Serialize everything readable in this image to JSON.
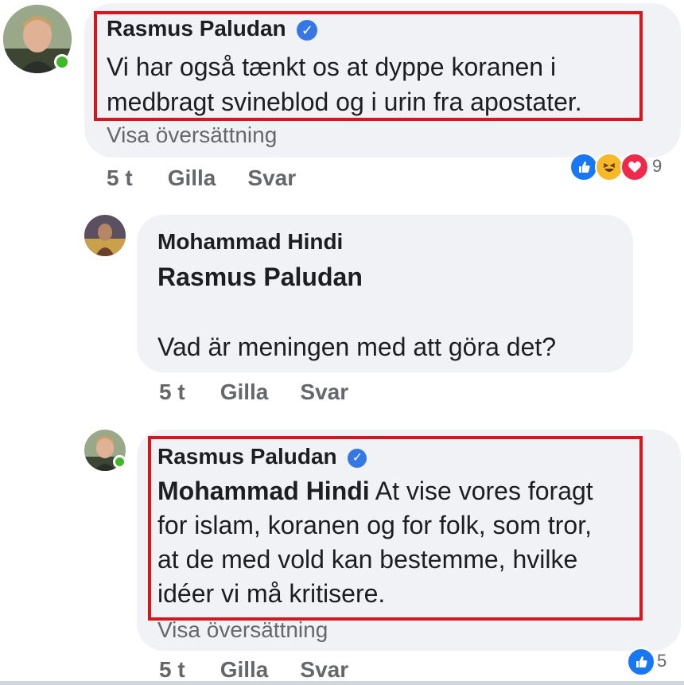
{
  "comments": [
    {
      "author": "Rasmus Paludan",
      "verified": true,
      "online": true,
      "text_lines": [
        "Vi har også tænkt os at dyppe koranen i",
        "medbragt svineblod og i urin fra apostater."
      ],
      "translate_label": "Visa översättning",
      "time": "5 t",
      "like_label": "Gilla",
      "reply_label": "Svar",
      "reactions": [
        "like-icon",
        "haha-icon",
        "love-icon"
      ],
      "reaction_count": "9"
    },
    {
      "author": "Mohammad Hindi",
      "verified": false,
      "online": false,
      "mention": "Rasmus Paludan",
      "text_lines": [
        "Vad är meningen med att göra det?"
      ],
      "time": "5 t",
      "like_label": "Gilla",
      "reply_label": "Svar"
    },
    {
      "author": "Rasmus Paludan",
      "verified": true,
      "online": true,
      "mention": "Mohammad Hindi",
      "text_lines": [
        "At vise vores foragt",
        "for islam, koranen og for folk, som tror,",
        "at de med vold kan bestemme, hvilke",
        "idéer vi må kritisere."
      ],
      "translate_label": "Visa översättning",
      "time": "5 t",
      "like_label": "Gilla",
      "reply_label": "Svar",
      "reactions": [
        "like-icon"
      ],
      "reaction_count": "5"
    }
  ],
  "colors": {
    "bubble": "#f0f2f5",
    "highlight": "#d6161c",
    "verified": "#3578e5",
    "online": "#42b72a",
    "meta": "#65676b"
  }
}
